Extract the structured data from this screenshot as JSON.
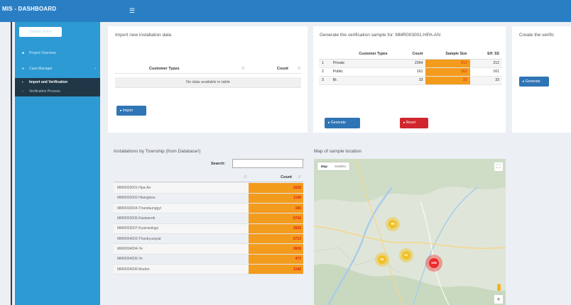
{
  "app": {
    "title": "MIS - DASHBOARD",
    "toggle_icon": "menu-icon"
  },
  "sidebar": {
    "button_label": "Sample Home",
    "items": [
      {
        "label": "Project Overview",
        "icon": "bullet-icon"
      },
      {
        "label": "Case Manager",
        "icon": "user-icon"
      },
      {
        "label": "Import and Verification",
        "icon": "caret-right-icon"
      },
      {
        "label": "Verification Process",
        "icon": "caret-right-icon"
      }
    ]
  },
  "import_panel": {
    "title": "Import new installation data",
    "columns": [
      "Customer Types",
      "Count"
    ],
    "empty_text": "No data available in table",
    "button_label": "Import"
  },
  "verification_panel": {
    "title": "Generate the verification sample for: MMR003001-HPA-AN",
    "columns": [
      "",
      "Customer Types",
      "Count",
      "Sample Size",
      "Eff. SS"
    ],
    "rows": [
      {
        "index": "1",
        "type": "Private",
        "count": "2364",
        "sample": "212",
        "eff": "212"
      },
      {
        "index": "2",
        "type": "Public",
        "count": "161",
        "sample": "161",
        "eff": "161"
      },
      {
        "index": "3",
        "type": "Br.",
        "count": "33",
        "sample": "33",
        "eff": "33"
      }
    ],
    "generate_label": "Generate",
    "reset_label": "Reset"
  },
  "create_panel": {
    "title": "Create the verific",
    "button_label": "Generate"
  },
  "township_panel": {
    "title": "Installations by Township (from Database!)",
    "search_label": "Search:",
    "search_value": "",
    "count_header": "Count",
    "rows": [
      {
        "name": "MMR003001-Hpa-An",
        "count": "3226"
      },
      {
        "name": "MMR003002-Hlaingbwe",
        "count": "1148"
      },
      {
        "name": "MMR003004-Thandaunggyi",
        "count": "166"
      },
      {
        "name": "MMR003006-Kawkareik",
        "count": "6742"
      },
      {
        "name": "MMR003007-Kyainseikgyi",
        "count": "2659"
      },
      {
        "name": "MMR004003-Thanbyuzayat",
        "count": "2713"
      },
      {
        "name": "MMR004004-Ye",
        "count": "3608"
      },
      {
        "name": "MMR004005-Ye",
        "count": "472"
      },
      {
        "name": "MMR004006-Mudon",
        "count": "1146"
      }
    ]
  },
  "map_panel": {
    "title": "Map of sample location",
    "tabs": [
      "Map",
      "Satellite"
    ],
    "clusters": [
      "98",
      "85",
      "51",
      "108"
    ],
    "zoom_label": "+"
  }
}
